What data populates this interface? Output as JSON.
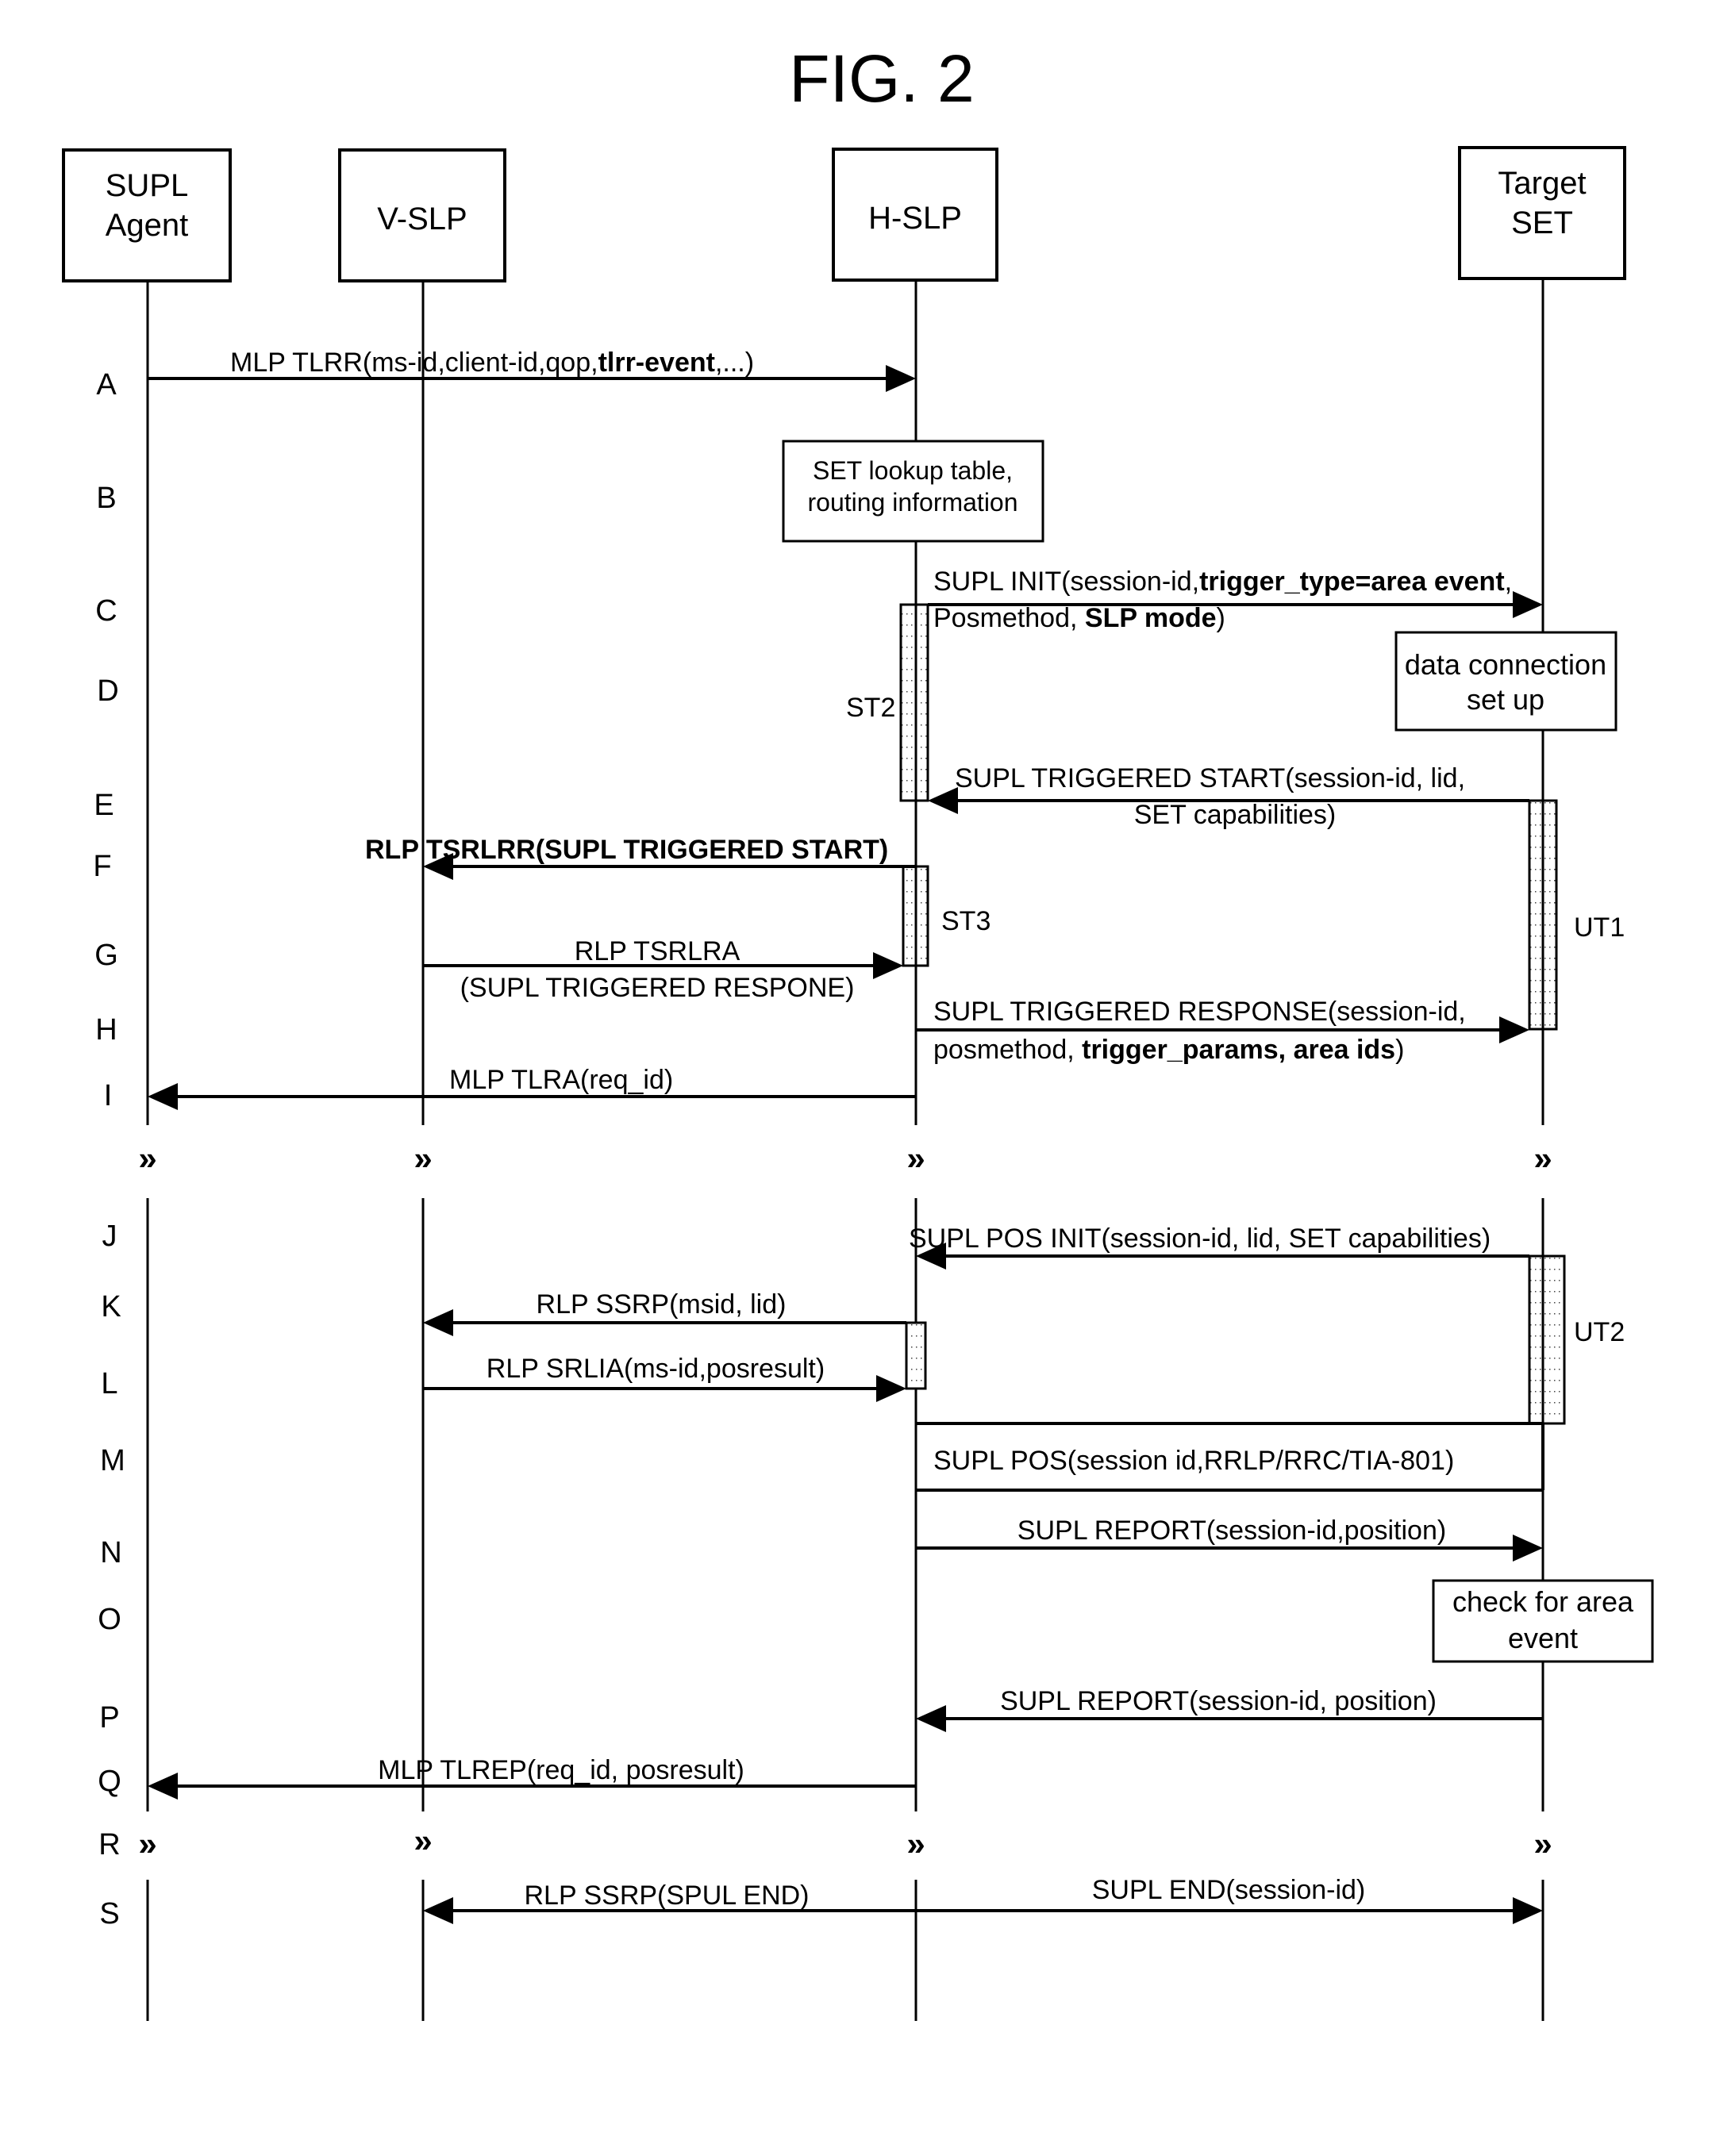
{
  "title": "FIG. 2",
  "participants": [
    {
      "id": "agent",
      "lines": [
        "SUPL",
        "Agent"
      ]
    },
    {
      "id": "vslp",
      "lines": [
        "V-SLP"
      ]
    },
    {
      "id": "hslp",
      "lines": [
        "H-SLP"
      ]
    },
    {
      "id": "set",
      "lines": [
        "Target",
        "SET"
      ]
    }
  ],
  "step_labels": [
    "A",
    "B",
    "C",
    "D",
    "E",
    "F",
    "G",
    "H",
    "I",
    "J",
    "K",
    "L",
    "M",
    "N",
    "O",
    "P",
    "Q",
    "R",
    "S"
  ],
  "break_mark": "»",
  "messages": {
    "A": {
      "from": "agent",
      "to": "hslp",
      "parts": [
        {
          "text": "MLP TLRR(ms-id,client-id,qop,",
          "bold": false
        },
        {
          "text": "tlrr-event",
          "bold": true
        },
        {
          "text": ",...)",
          "bold": false
        }
      ]
    },
    "C": {
      "from": "hslp",
      "to": "set",
      "line1": [
        {
          "text": "SUPL INIT(session-id,",
          "bold": false
        },
        {
          "text": "trigger_type=area event",
          "bold": true
        },
        {
          "text": ",",
          "bold": false
        }
      ],
      "line2": [
        {
          "text": "Posmethod, ",
          "bold": false
        },
        {
          "text": "SLP mode",
          "bold": true
        },
        {
          "text": ")",
          "bold": false
        }
      ]
    },
    "E": {
      "from": "set",
      "to": "hslp",
      "line1": "SUPL TRIGGERED START(session-id, lid,",
      "line2": "SET capabilities)"
    },
    "F": {
      "from": "hslp",
      "to": "vslp",
      "text": "RLP TSRLRR(SUPL TRIGGERED START)",
      "bold": true
    },
    "G": {
      "from": "vslp",
      "to": "hslp",
      "line1": "RLP TSRLRA",
      "line2": "(SUPL TRIGGERED RESPONE)"
    },
    "H": {
      "from": "hslp",
      "to": "set",
      "line1": [
        {
          "text": "SUPL TRIGGERED RESPONSE(session-id,",
          "bold": false
        }
      ],
      "line2": [
        {
          "text": "posmethod, ",
          "bold": false
        },
        {
          "text": "trigger_params, area ids",
          "bold": true
        },
        {
          "text": ")",
          "bold": false
        }
      ]
    },
    "I": {
      "from": "hslp",
      "to": "agent",
      "text": "MLP TLRA(req_id)"
    },
    "J": {
      "from": "set",
      "to": "hslp",
      "text": "SUPL POS INIT(session-id, lid, SET capabilities)"
    },
    "K": {
      "from": "hslp",
      "to": "vslp",
      "text": "RLP SSRP(msid, lid)"
    },
    "L": {
      "from": "vslp",
      "to": "hslp",
      "text": "RLP SRLIA(ms-id,posresult)"
    },
    "M": {
      "between": [
        "hslp",
        "set"
      ],
      "text": "SUPL POS(session id,RRLP/RRC/TIA-801)"
    },
    "N": {
      "from": "hslp",
      "to": "set",
      "text": "SUPL REPORT(session-id,position)"
    },
    "P": {
      "from": "set",
      "to": "hslp",
      "text": "SUPL REPORT(session-id, position)"
    },
    "Q": {
      "from": "hslp",
      "to": "agent",
      "text": "MLP TLREP(req_id, posresult)"
    },
    "S_left": {
      "from": "hslp",
      "to": "vslp",
      "text": "RLP SSRP(SPUL END)"
    },
    "S_right": {
      "from": "hslp",
      "to": "set",
      "text": "SUPL END(session-id)"
    }
  },
  "notes": {
    "B": [
      "SET lookup table,",
      "routing information"
    ],
    "D": [
      "data connection",
      "set up"
    ],
    "O": [
      "check for area",
      "event"
    ]
  },
  "timers": {
    "ST2": "ST2",
    "ST3": "ST3",
    "UT1": "UT1",
    "UT2": "UT2"
  }
}
